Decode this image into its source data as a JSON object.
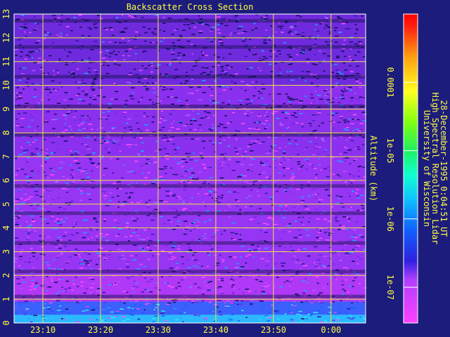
{
  "chart_data": {
    "type": "heatmap",
    "title": "Backscatter Cross Section",
    "ylabel": "Altitude (km)",
    "xlabel": "",
    "x_ticks": [
      "23:10",
      "23:20",
      "23:30",
      "23:40",
      "23:50",
      "0:00"
    ],
    "y_ticks": [
      "0",
      "1",
      "2",
      "3",
      "4",
      "5",
      "6",
      "7",
      "8",
      "9",
      "10",
      "11",
      "12",
      "13"
    ],
    "ylim": [
      0,
      13
    ],
    "x_minutes_range": [
      1385,
      1446
    ],
    "x_tick_minutes": [
      1390,
      1400,
      1410,
      1420,
      1430,
      1440
    ],
    "grid": true,
    "colorbar": {
      "scale": "log",
      "range": [
        3e-08,
        0.001
      ],
      "tick_values": [
        1e-07,
        1e-06,
        1e-05,
        0.0001
      ],
      "tick_labels": [
        "1e-07",
        "1e-06",
        "1e-05",
        "0.0001"
      ]
    },
    "annotation": {
      "lines": [
        "University of Wisconsin",
        "High Spectral Resolution Lidar",
        "28-December-1995  0:04:51 UT"
      ]
    }
  },
  "colors": {
    "background": "#1c1c7c",
    "grid": "#e8e840",
    "text": "#ffff40",
    "frame": "#ffffff"
  }
}
